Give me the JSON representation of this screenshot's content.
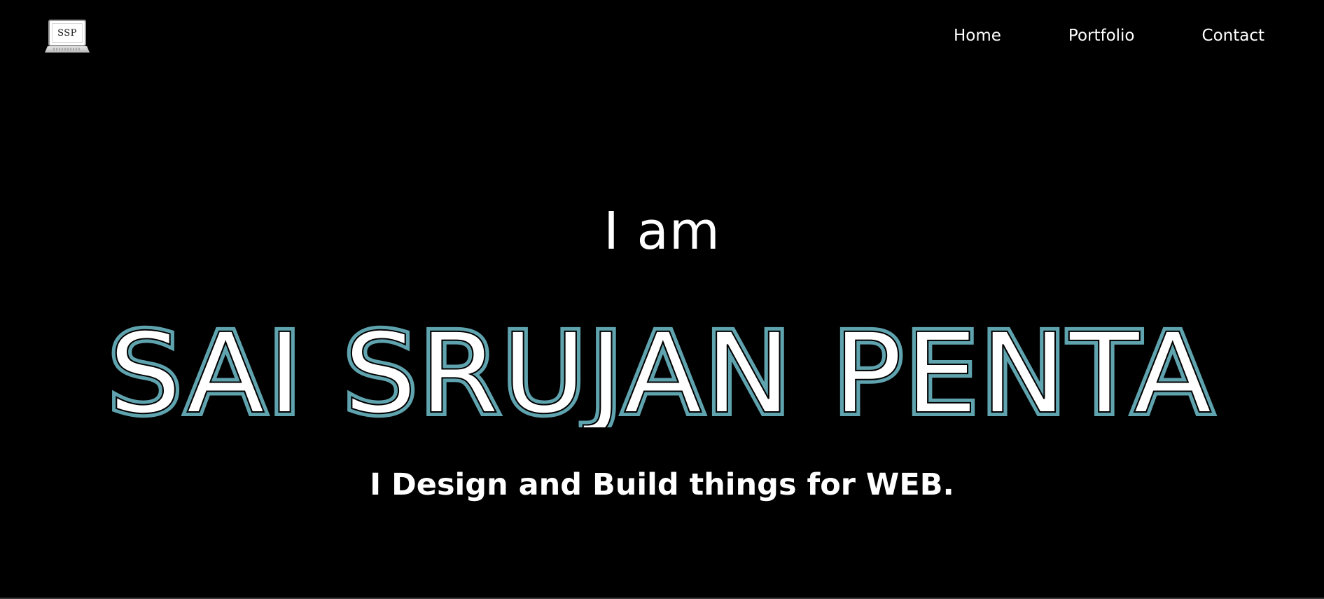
{
  "header": {
    "logo": {
      "text": "SSP",
      "icon": "laptop-icon"
    },
    "nav": [
      {
        "label": "Home"
      },
      {
        "label": "Portfolio"
      },
      {
        "label": "Contact"
      }
    ]
  },
  "hero": {
    "intro": "I am",
    "name": "SAI SRUJAN PENTA",
    "tagline": "I Design and Build things for WEB."
  },
  "colors": {
    "background": "#000000",
    "text": "#ffffff",
    "name_outline": "#5fa3ae"
  }
}
